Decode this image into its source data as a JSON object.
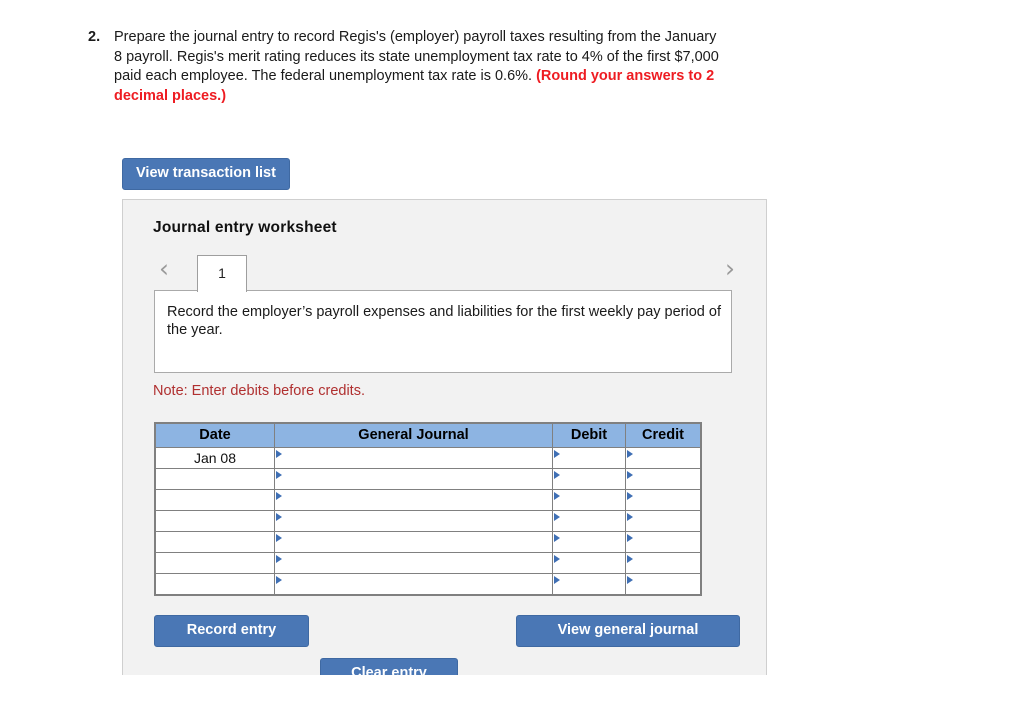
{
  "question": {
    "number": "2.",
    "text_part1": "Prepare the journal entry to record Regis's (employer) payroll taxes resulting from the January 8 payroll. Regis's merit rating reduces its state unemployment tax rate to 4% of the first $7,000 paid each employee. The federal unemployment tax rate is 0.6%. ",
    "highlight": "(Round your answers to 2 decimal places.)"
  },
  "toolbar": {
    "view_transaction_list": "View transaction list"
  },
  "worksheet": {
    "title": "Journal entry worksheet",
    "prev_icon": "chevron-left-icon",
    "next_icon": "chevron-right-icon",
    "tabs": [
      {
        "label": "1",
        "active": true
      }
    ],
    "description": "Record the employer’s payroll expenses and liabilities for the first weekly pay period of the year.",
    "note": "Note: Enter debits before credits."
  },
  "journal": {
    "columns": [
      "Date",
      "General Journal",
      "Debit",
      "Credit"
    ],
    "rows": [
      {
        "date": "Jan 08",
        "general_journal": "",
        "debit": "",
        "credit": ""
      },
      {
        "date": "",
        "general_journal": "",
        "debit": "",
        "credit": ""
      },
      {
        "date": "",
        "general_journal": "",
        "debit": "",
        "credit": ""
      },
      {
        "date": "",
        "general_journal": "",
        "debit": "",
        "credit": ""
      },
      {
        "date": "",
        "general_journal": "",
        "debit": "",
        "credit": ""
      },
      {
        "date": "",
        "general_journal": "",
        "debit": "",
        "credit": ""
      },
      {
        "date": "",
        "general_journal": "",
        "debit": "",
        "credit": ""
      }
    ]
  },
  "actions": {
    "record_entry": "Record entry",
    "clear_entry": "Clear entry",
    "view_general_journal": "View general journal"
  },
  "colors": {
    "button_blue": "#4a77b5",
    "table_header_blue": "#8db4e2",
    "panel_background": "#f2f2f2",
    "highlight_red": "#ee1c22",
    "note_red": "#b03030",
    "dropdown_triangle_blue": "#3f6fb4"
  }
}
